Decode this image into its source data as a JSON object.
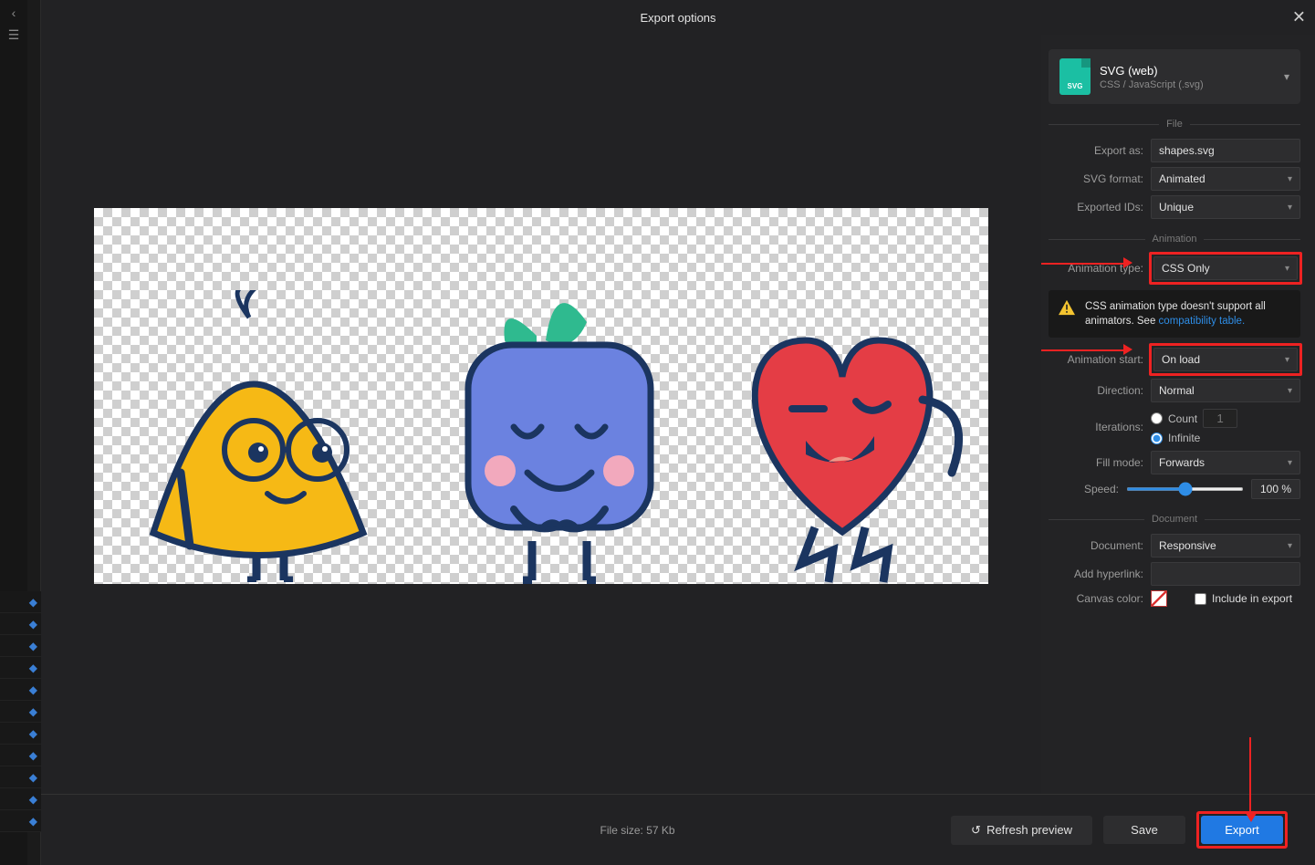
{
  "dialog": {
    "title": "Export options"
  },
  "format": {
    "name": "SVG (web)",
    "subtitle": "CSS / JavaScript (.svg)",
    "badge": "SVG"
  },
  "sections": {
    "file": "File",
    "animation": "Animation",
    "document": "Document"
  },
  "labels": {
    "export_as": "Export as:",
    "svg_format": "SVG format:",
    "exported_ids": "Exported IDs:",
    "animation_type": "Animation type:",
    "animation_start": "Animation start:",
    "direction": "Direction:",
    "iterations": "Iterations:",
    "fill_mode": "Fill mode:",
    "speed": "Speed:",
    "document": "Document:",
    "add_hyperlink": "Add hyperlink:",
    "canvas_color": "Canvas color:",
    "include_in_export": "Include in export"
  },
  "values": {
    "filename": "shapes.svg",
    "svg_format": "Animated",
    "exported_ids": "Unique",
    "animation_type": "CSS Only",
    "animation_start": "On load",
    "direction": "Normal",
    "iteration_count": "Count",
    "iteration_count_num": "1",
    "iteration_infinite": "Infinite",
    "fill_mode": "Forwards",
    "speed": "100",
    "speed_unit": "%",
    "document": "Responsive",
    "hyperlink": ""
  },
  "warning": {
    "text1": "CSS animation type doesn't support all animators. See ",
    "link_text": "compatibility table.",
    "link": "compatibility table"
  },
  "footer": {
    "filesize_label": "File size: 57 Kb",
    "refresh": "Refresh preview",
    "save": "Save",
    "export": "Export"
  }
}
